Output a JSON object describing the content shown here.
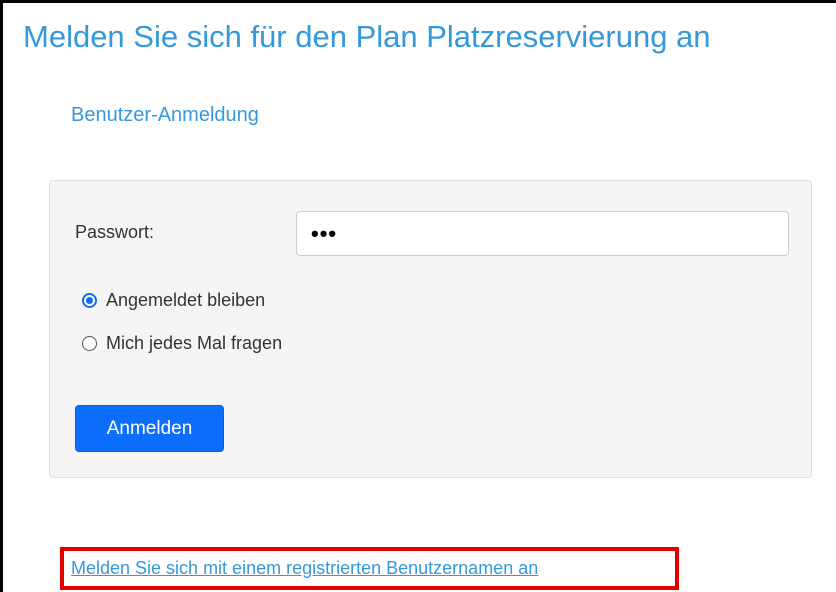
{
  "page": {
    "title": "Melden Sie sich für den Plan Platzreservierung an",
    "section_heading": "Benutzer-Anmeldung"
  },
  "form": {
    "password_label": "Passwort:",
    "password_value": "•••",
    "radio_options": [
      {
        "label": "Angemeldet bleiben",
        "checked": true
      },
      {
        "label": "Mich jedes Mal fragen",
        "checked": false
      }
    ],
    "login_button_label": "Anmelden"
  },
  "footer": {
    "register_link_text": "Melden Sie sich mit einem registrierten Benutzernamen an"
  },
  "colors": {
    "title_blue": "#3598db",
    "button_blue": "#0d6efd",
    "highlight_red": "#e00000",
    "panel_bg": "#f5f5f5"
  }
}
